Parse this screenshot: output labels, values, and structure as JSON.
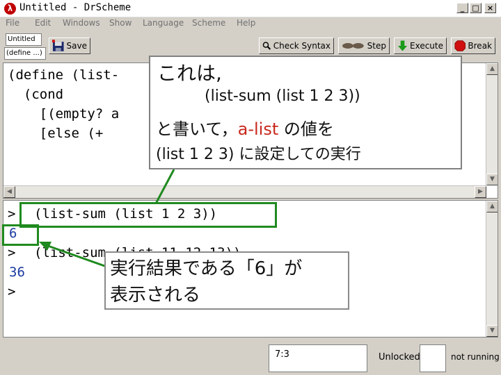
{
  "window": {
    "title": "Untitled - DrScheme",
    "app_icon_glyph": "λ",
    "controls": [
      "_",
      "□",
      "×"
    ]
  },
  "menu": [
    "File",
    "Edit",
    "Windows",
    "Show",
    "Language",
    "Scheme",
    "Help"
  ],
  "toolbar": {
    "file_label": "Untitled",
    "define_label": "(define ...)",
    "save_label": "Save",
    "check_syntax_label": "Check Syntax",
    "step_label": "Step",
    "execute_label": "Execute",
    "break_label": "Break",
    "colors": {
      "check": "#1a3aa0",
      "execute": "#1a9a1a",
      "break": "#d01010"
    }
  },
  "definitions": {
    "lines": [
      "(define (list-",
      "  (cond",
      "    [(empty? a",
      "    [else (+"
    ]
  },
  "interactions": {
    "prompt": ">",
    "line1": "(list-sum (list 1 2 3))",
    "result1": "6",
    "line2": "(list-sum (list 11 12 13))",
    "result2": "36",
    "prompt3": ">"
  },
  "callout_top": {
    "line1": "これは,",
    "line2": "(list-sum (list 1 2 3))",
    "line3_pre": "と書いて，",
    "line3_hl": "a-list",
    "line3_post": "の値を",
    "line4": "(list 1 2 3) に設定しての実行"
  },
  "callout_bottom": {
    "line1": "実行結果である「6」が",
    "line2": "表示される"
  },
  "status": {
    "position": "7:3",
    "lock": "Unlocked",
    "running": "not running"
  },
  "colors": {
    "highlight_box": "#1f8a1f",
    "result_text": "#1a3aa0",
    "accent_red": "#c8281e"
  }
}
